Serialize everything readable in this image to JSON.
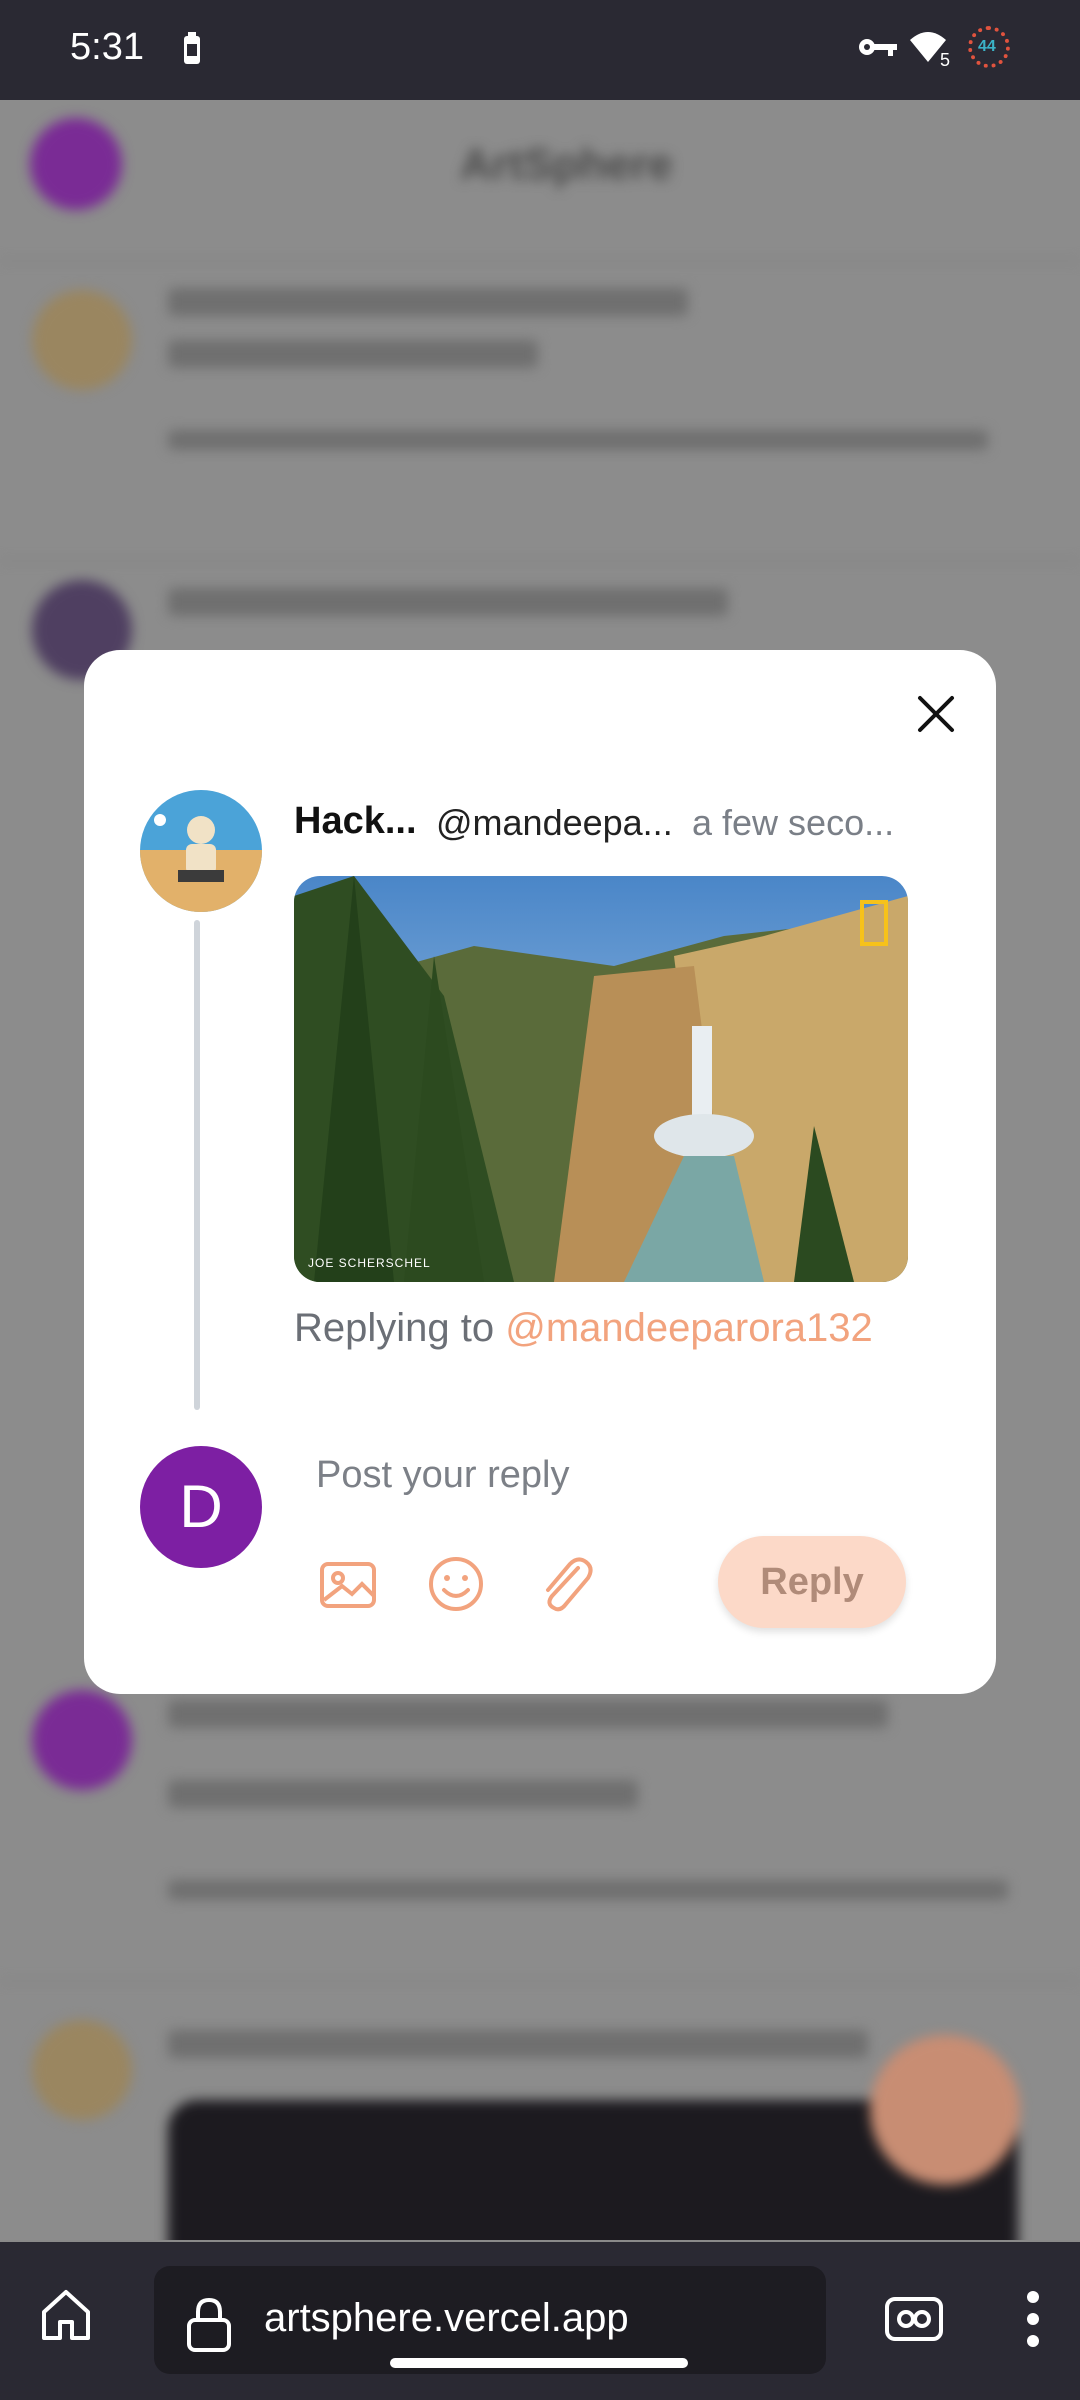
{
  "status_bar": {
    "time": "5:31",
    "wifi_badge": "5",
    "ring_value": "44"
  },
  "background": {
    "app_title": "ArtSphere"
  },
  "modal": {
    "post": {
      "name": "Hack...",
      "handle": "@mandeepa...",
      "time": "a few seco...",
      "photo_credit": "JOE SCHERSCHEL"
    },
    "replying_prefix": "Replying to ",
    "replying_handle": "@mandeeparora132",
    "reply_avatar_letter": "D",
    "input_placeholder": "Post your reply",
    "reply_button": "Reply",
    "accent_color": "#f2a37e",
    "avatar_color": "#7d1fa3"
  },
  "browser": {
    "url": "artsphere.vercel.app"
  }
}
